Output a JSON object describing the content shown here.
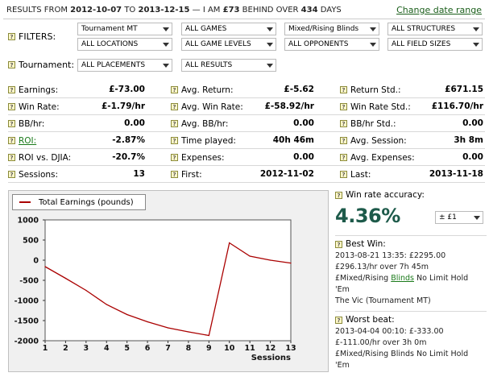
{
  "header": {
    "prefix": "RESULTS FROM",
    "from_date": "2012-10-07",
    "to_word": "TO",
    "to_date": "2013-12-15",
    "mid": "— I AM",
    "amount": "£73",
    "behind": "BEHIND OVER",
    "days": "434",
    "days_word": "DAYS",
    "change_link": "Change date range"
  },
  "filters": {
    "label": "FILTERS:",
    "selects": [
      "Tournament MT",
      "ALL GAMES",
      "Mixed/Rising Blinds",
      "ALL STRUCTURES",
      "ALL LOCATIONS",
      "ALL GAME LEVELS",
      "ALL OPPONENTS",
      "ALL FIELD SIZES"
    ]
  },
  "tournament": {
    "label": "Tournament:",
    "selects": [
      "ALL PLACEMENTS",
      "ALL RESULTS"
    ]
  },
  "stats": [
    [
      {
        "label": "Earnings:",
        "value": "£-73.00"
      },
      {
        "label": "Avg. Return:",
        "value": "£-5.62"
      },
      {
        "label": "Return Std.:",
        "value": "£671.15"
      }
    ],
    [
      {
        "label": "Win Rate:",
        "value": "£-1.79/hr"
      },
      {
        "label": "Avg. Win Rate:",
        "value": "£-58.92/hr"
      },
      {
        "label": "Win Rate Std.:",
        "value": "£116.70/hr"
      }
    ],
    [
      {
        "label": "BB/hr:",
        "value": "0.00"
      },
      {
        "label": "Avg. BB/hr:",
        "value": "0.00"
      },
      {
        "label": "BB/hr Std.:",
        "value": "0.00"
      }
    ],
    [
      {
        "label": "ROI:",
        "value": "-2.87%"
      },
      {
        "label": "Time played:",
        "value": "40h 46m"
      },
      {
        "label": "Avg. Session:",
        "value": "3h 8m"
      }
    ],
    [
      {
        "label": "ROI vs. DJIA:",
        "value": "-20.7%"
      },
      {
        "label": "Expenses:",
        "value": "0.00"
      },
      {
        "label": "Avg. Expenses:",
        "value": "0.00"
      }
    ],
    [
      {
        "label": "Sessions:",
        "value": "13"
      },
      {
        "label": "First:",
        "value": "2012-11-02"
      },
      {
        "label": "Last:",
        "value": "2013-11-18"
      }
    ]
  ],
  "right": {
    "accuracy_label": "Win rate accuracy:",
    "accuracy_value": "4.36%",
    "accuracy_select": "± £1",
    "best_label": "Best Win:",
    "best_line1": "2013-08-21 13:35: £2295.00",
    "best_line2": "£296.13/hr over 7h 45m",
    "best_line3_pre": "£Mixed/Rising",
    "best_line3_link": "Blinds",
    "best_line3_post": "No Limit Hold",
    "best_line4": "'Em",
    "best_line5": "The Vic (Tournament MT)",
    "worst_label": "Worst beat:",
    "worst_line1": "2013-04-04 00:10: £-333.00",
    "worst_line2": "£-111.00/hr over 3h 0m",
    "worst_line3": "£Mixed/Rising Blinds No Limit Hold",
    "worst_line4": "'Em"
  },
  "colors": {
    "accent_green": "#1a5e1a",
    "line_red": "#aa0000",
    "big_pct": "#1d5a4a"
  },
  "chart_data": {
    "type": "line",
    "xlabel": "Sessions",
    "ylabel": "",
    "x": [
      1,
      2,
      3,
      4,
      5,
      6,
      7,
      8,
      9,
      10,
      11,
      12,
      13
    ],
    "series": [
      {
        "name": "Total Earnings (pounds)",
        "values": [
          -160,
          -450,
          -750,
          -1100,
          -1350,
          -1530,
          -1680,
          -1780,
          -1870,
          430,
          100,
          0,
          -73
        ]
      }
    ],
    "xlim": [
      1,
      13
    ],
    "ylim": [
      -2000,
      1000
    ],
    "yticks": [
      1000,
      500,
      0,
      -500,
      -1000,
      -1500,
      -2000
    ],
    "grid": false,
    "legend": "top-left"
  }
}
